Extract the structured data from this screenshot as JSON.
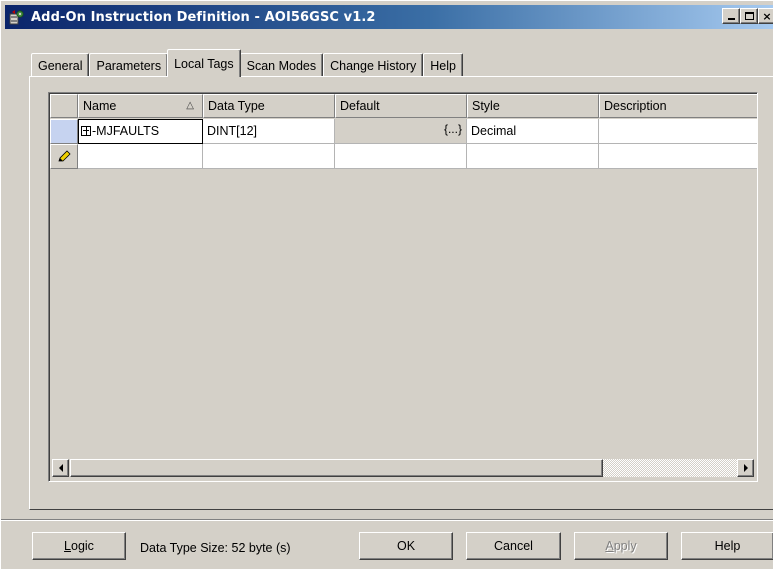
{
  "window": {
    "title": "Add-On Instruction Definition - AOI56GSC v1.2",
    "title_buttons": [
      "minimize",
      "maximize",
      "close"
    ],
    "close_glyph": "×"
  },
  "tabs": [
    {
      "label": "General",
      "active": false
    },
    {
      "label": "Parameters",
      "active": false
    },
    {
      "label": "Local Tags",
      "active": true
    },
    {
      "label": "Scan Modes",
      "active": false
    },
    {
      "label": "Change History",
      "active": false
    },
    {
      "label": "Help",
      "active": false
    }
  ],
  "grid": {
    "columns": [
      {
        "label": "Name",
        "sort": "ascending",
        "sort_glyph": "△"
      },
      {
        "label": "Data Type"
      },
      {
        "label": "Default"
      },
      {
        "label": "Style"
      },
      {
        "label": "Description"
      }
    ],
    "rows": [
      {
        "name": "-MJFAULTS",
        "data_type": "DINT[12]",
        "default": "{...}",
        "style": "Decimal",
        "description": ""
      }
    ],
    "new_row_icon": "pencil-icon"
  },
  "footer": {
    "logic_label": "Logic",
    "logic_mnemonic": "L",
    "logic_rest": "ogic",
    "status": "Data Type Size: 52 byte (s)",
    "ok_label": "OK",
    "cancel_label": "Cancel",
    "apply_label": "Apply",
    "apply_mnemonic": "A",
    "apply_rest": "pply",
    "help_label": "Help"
  },
  "colors": {
    "title_gradient_start": "#0a246a",
    "title_gradient_end": "#a6caf0",
    "face": "#d4d0c8",
    "selected_row_header": "#c6d3f0"
  }
}
